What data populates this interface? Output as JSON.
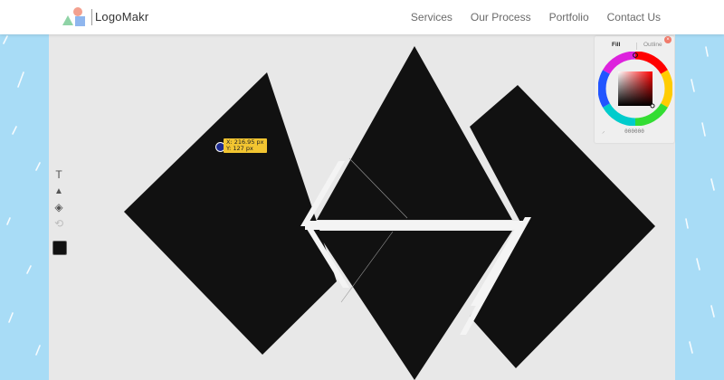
{
  "brand": {
    "name": "LogoMakr"
  },
  "nav": {
    "items": [
      {
        "label": "Services"
      },
      {
        "label": "Our Process"
      },
      {
        "label": "Portfolio"
      },
      {
        "label": "Contact Us"
      }
    ]
  },
  "canvas": {
    "background": "#e8e8e8",
    "shape_color": "#111111",
    "tooltip": {
      "x_label": "X: 216.95 px",
      "y_label": "Y: 127 px"
    }
  },
  "toolbar": {
    "tools": [
      {
        "name": "text-tool",
        "icon": "text-icon",
        "glyph": "T"
      },
      {
        "name": "shape-tool",
        "icon": "triangle-icon",
        "glyph": "▲"
      },
      {
        "name": "clipart-tool",
        "icon": "clipart-icon",
        "glyph": "◈"
      },
      {
        "name": "history-tool",
        "icon": "history-icon",
        "glyph": "⟲"
      }
    ],
    "current_color": "#111111"
  },
  "color_panel": {
    "tabs": {
      "fill": "Fill",
      "outline": "Outline"
    },
    "close_glyph": "×",
    "hex": "000000",
    "accent": "#f07a6a"
  }
}
